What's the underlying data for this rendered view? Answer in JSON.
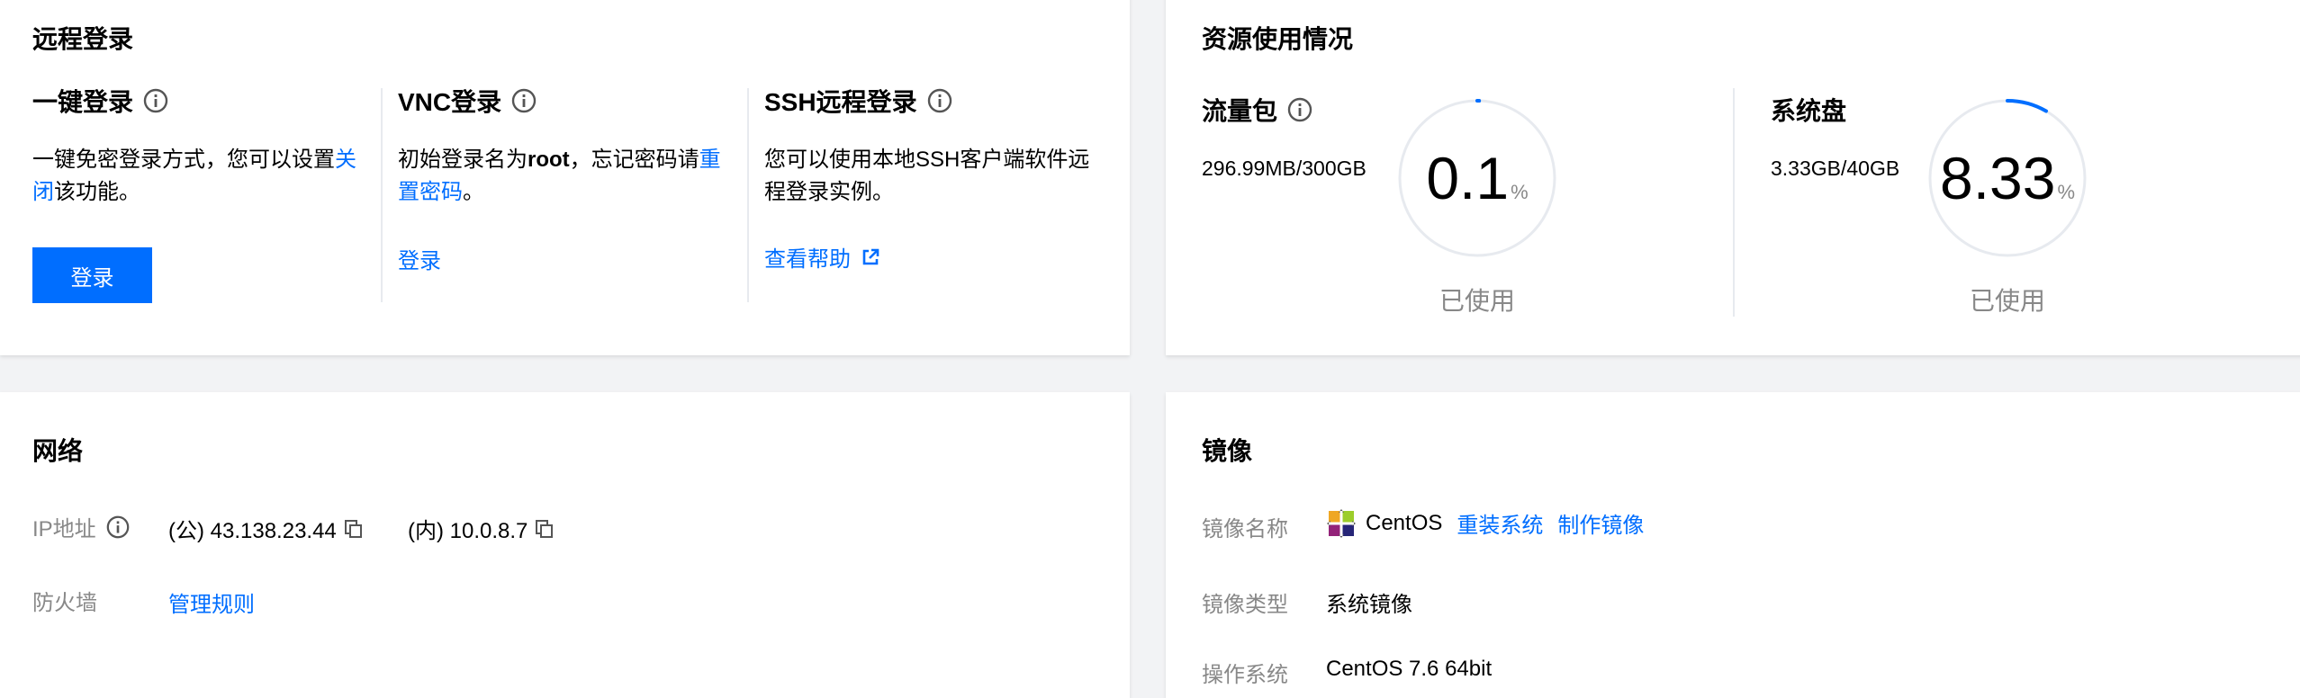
{
  "remote_login": {
    "title": "远程登录",
    "one_click": {
      "title": "一键登录",
      "desc_prefix": "一键免密登录方式，您可以设置",
      "desc_link": "关闭",
      "desc_suffix": "该功能。",
      "button": "登录"
    },
    "vnc": {
      "title": "VNC登录",
      "desc_prefix": "初始登录名为",
      "desc_bold": "root",
      "desc_suffix": "，忘记密码请",
      "desc_link": "重置密码",
      "desc_end": "。",
      "link": "登录"
    },
    "ssh": {
      "title": "SSH远程登录",
      "desc_line1": "您可以使用本地SSH客户端软件远",
      "desc_line2": "程登录实例。",
      "link": "查看帮助"
    }
  },
  "resource": {
    "title": "资源使用情况",
    "traffic": {
      "title": "流量包",
      "usage": "296.99MB/300GB",
      "percent": "0.1",
      "unit": "%",
      "caption": "已使用",
      "fraction": 0.001
    },
    "disk": {
      "title": "系统盘",
      "usage": "3.33GB/40GB",
      "percent": "8.33",
      "unit": "%",
      "caption": "已使用",
      "fraction": 0.0833
    },
    "colors": {
      "track": "#e7eaef",
      "arc": "#006eff"
    }
  },
  "network": {
    "title": "网络",
    "ip_label": "IP地址",
    "public_ip": "(公) 43.138.23.44",
    "private_ip": "(内) 10.0.8.7",
    "firewall_label": "防火墙",
    "firewall_link": "管理规则"
  },
  "image": {
    "title": "镜像",
    "name_label": "镜像名称",
    "name_value": "CentOS",
    "reinstall_link": "重装系统",
    "make_image_link": "制作镜像",
    "type_label": "镜像类型",
    "type_value": "系统镜像",
    "os_label": "操作系统",
    "os_value": "CentOS 7.6 64bit"
  },
  "colors": {
    "accent": "#006eff",
    "muted": "#888888",
    "background": "#f2f3f5"
  }
}
